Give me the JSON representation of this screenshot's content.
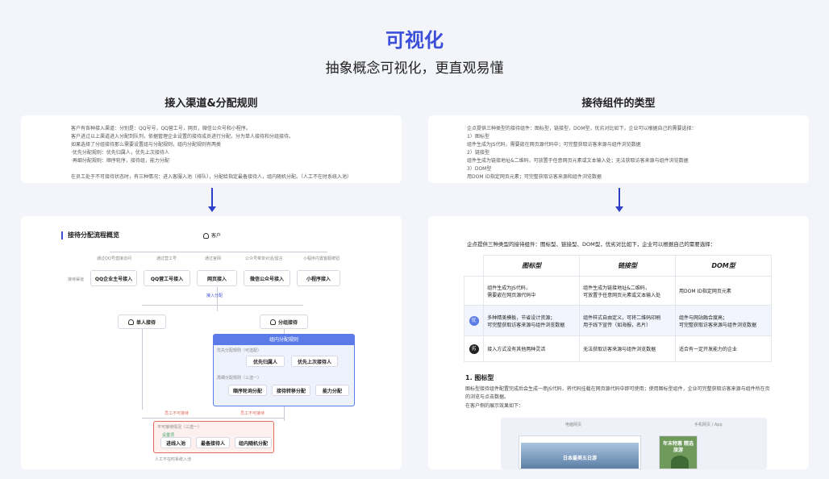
{
  "header": {
    "title": "可视化",
    "subtitle": "抽象概念可视化，更直观易懂"
  },
  "left": {
    "heading": "接入渠道&分配规则",
    "text_lines": [
      "客户有各种接入渠道：分别是：QQ号号，QQ营工号，网页，微信公众号和小程序。",
      "客户进过以上渠道进入分配到队列，依据管理企业设置的接待成员进行分配，分为单人接待和分组接待。",
      "如果选择了分组接待那么需要设置组与分配规则，组内分配规则有两类",
      "·优先分配规则：优先归属人，优先上次接待人",
      "·再细分配规则：顺序轮序，接待组，能力分配",
      "",
      "在员工处于不可接待状态时，有三种情况：进入客服入池（排队），分配给指定最备接待人，组内随机分配。（人工不在时系统入池）"
    ],
    "flow": {
      "title": "接待分配流程概览",
      "customer": "客户",
      "channel_label": "接待渠道",
      "channel_notes": [
        "通过QQ号直接访问",
        "通过营工号",
        "通过官网",
        "公众号菜单对话/留言",
        "小程序内置客服按钮"
      ],
      "channels": [
        "QQ企业主号接入",
        "QQ营工号接入",
        "网页接入",
        "微信公众号接入",
        "小程序接入"
      ],
      "enter_assign": "接入分配",
      "single": "单人接待",
      "group": "分组接待",
      "group_rule": "组内分配规则",
      "priority_label": "优先分配规则（可选配）",
      "priority": [
        "优先归属人",
        "优先上次接待人"
      ],
      "rest_label": "再细分配规则（三选一）",
      "rest": [
        "顺序轮询分配",
        "接待转移分配",
        "能力分配"
      ],
      "off_note": "员工不可接待",
      "off_box_label": "不可接待情况（三选一）",
      "off_sub": "设置项",
      "off": [
        "进线入池",
        "最备接待人",
        "组内随机分配"
      ],
      "footer": "人工不在时系统入池"
    }
  },
  "right": {
    "heading": "接待组件的类型",
    "text_lines": [
      "企点提供三种类型的接待组件：图标型，链接型，DOM型，优劣对比如下，企业可以根据自己的需要选择：",
      "1）图标型",
      "组件生成为JS代码，需要嵌在网页源代码中；可完整获取访客来源与组件浏览数据",
      "2）链接型",
      "组件生成为链接地址&二维码，可放置于任意网页元素或文本输入处；无法获取访客来源与组件浏览数据",
      "3）DOM型",
      "用DOM ID指定网页元素；可完整获取访客来源和组件浏览数据"
    ],
    "intro": "企点提供三种类型的接待组件：图标型、链接型、DOM型，优劣对比如下，企业可以根据自己的需要选择：",
    "table": {
      "headers": [
        "图标型",
        "链接型",
        "DOM型"
      ],
      "rows": [
        {
          "badge": "",
          "cells": [
            "组件生成为JS代码，\n需要嵌在网页源代码中",
            "组件生成为链接地址&二维码，\n可放置于任意网页元素或文本输入处",
            "用DOM ID指定网页元素"
          ]
        },
        {
          "badge": "优",
          "cells": [
            "多种精美模板，节省设计资源；\n可完整获取访客来源与组件浏览数据",
            "组件样式自由定义，可将二维码印刷\n用于线下宣传（如海报，名片）",
            "组件与网站融合度高；\n可完整获取访客来源与组件浏览数据"
          ]
        },
        {
          "badge": "劣",
          "cells": [
            "接入方式没有其他两种灵活",
            "无法获取访客来源与组件浏览数据",
            "适合有一定开发能力的企业"
          ]
        }
      ]
    },
    "section1_title": "1. 图标型",
    "section1_text": "图标型接待组件配置完成后会生成一串JS代码，将代码挂载在网页源代码中即可使用；使用图标型组件，企业可完整获取访客来源与组件所在页的浏览与点击数据。",
    "section1_text2": "在客户侧的展示效果如下：",
    "preview_left_label": "电脑网页",
    "preview_right_label": "手机网页 / App",
    "preview_banner_text": "日本最美五日游",
    "preview_mobile_text": "年末特惠 精选旅游"
  },
  "colors": {
    "accent": "#3b4fd8",
    "arrow": "#2d3fc9",
    "group_blue": "#5b7be8",
    "warn_red": "#e06b5c"
  }
}
